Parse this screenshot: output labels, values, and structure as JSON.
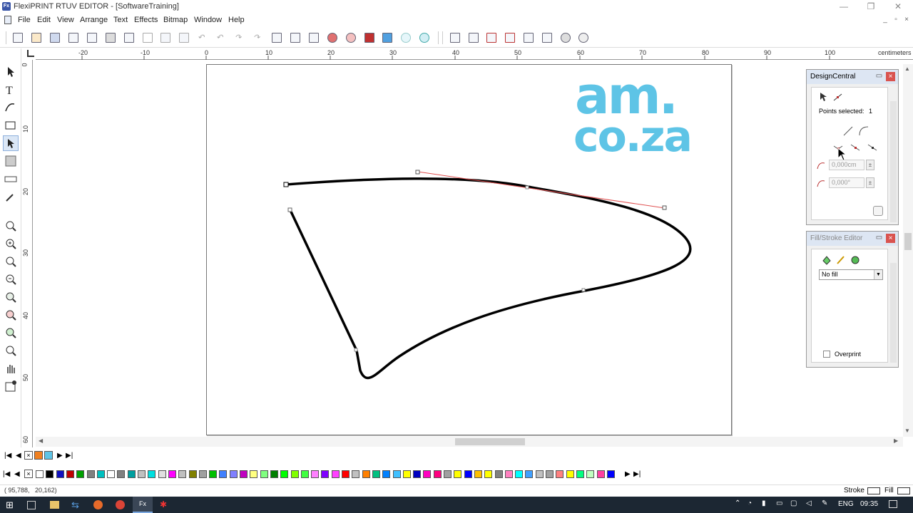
{
  "window": {
    "title": "FlexiPRINT RTUV EDITOR - [SoftwareTraining]",
    "app_icon": "Fx"
  },
  "menu": [
    "File",
    "Edit",
    "View",
    "Arrange",
    "Text",
    "Effects",
    "Bitmap",
    "Window",
    "Help"
  ],
  "ruler": {
    "unit": "centimeters",
    "h_ticks": [
      "-20",
      "-10",
      "0",
      "10",
      "20",
      "30",
      "40",
      "50",
      "60",
      "70",
      "80",
      "90",
      "100"
    ],
    "v_ticks": [
      "0",
      "10",
      "20",
      "30",
      "40",
      "50",
      "60"
    ]
  },
  "logo": {
    "line1": "am.",
    "line2": "co.za",
    "color": "#5ec4e6"
  },
  "design_central": {
    "title": "DesignCentral",
    "points_label": "Points selected:",
    "points_value": "1",
    "field1": "0,000cm",
    "field2": "0,000°"
  },
  "fill_stroke": {
    "title": "Fill/Stroke Editor",
    "fill_value": "No fill",
    "overprint_label": "Overprint"
  },
  "status": {
    "coords_x": "95,788",
    "coords_y": "20,162",
    "stroke_label": "Stroke",
    "fill_label": "Fill"
  },
  "taskbar": {
    "lang": "ENG",
    "time": "09:35"
  },
  "colors": {
    "accent": "#3a56a8",
    "control_handle": "#e05050",
    "taskbar": "#1c2733"
  },
  "palette": [
    "#ffffff",
    "#000000",
    "#1010c0",
    "#c00000",
    "#00a000",
    "#808080",
    "#00c0c0",
    "#ffffff",
    "#808080",
    "#00a0a0",
    "#c0c0c0",
    "#00e0e0",
    "#e0e0e0",
    "#ff00ff",
    "#c0c0c0",
    "#808000",
    "#a0a0a0",
    "#00c000",
    "#4080ff",
    "#8080ff",
    "#c000c0",
    "#ffff80",
    "#80ff80",
    "#008000",
    "#00ff00",
    "#80ff00",
    "#40ff40",
    "#ff80ff",
    "#8000ff",
    "#ff40ff",
    "#ff0000",
    "#c0c0c0",
    "#ff8000",
    "#00c080",
    "#0080ff",
    "#40c0ff",
    "#ffff00",
    "#0000c0",
    "#ff00c0",
    "#ff0080",
    "#a0a0a0",
    "#ffff00",
    "#0000ff",
    "#ffc000",
    "#ffff00",
    "#808080",
    "#ff80c0",
    "#00ffff",
    "#40a0ff",
    "#c0c0c0",
    "#a0a0a0",
    "#ff8080",
    "#ffff00",
    "#00ff80",
    "#c0ffc0",
    "#ff40a0",
    "#0000ff"
  ]
}
